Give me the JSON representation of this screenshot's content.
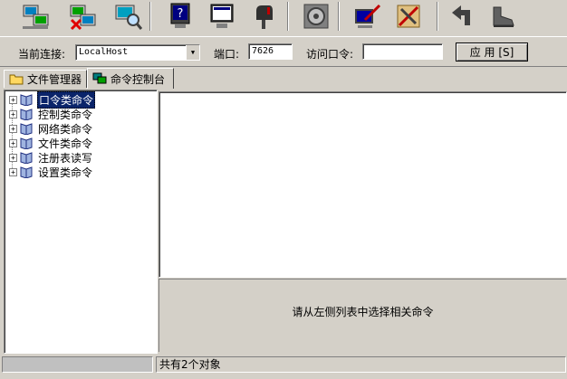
{
  "toolbar": {
    "buttons": [
      {
        "icon": "computer-connect-icon"
      },
      {
        "icon": "computer-disconnect-icon"
      },
      {
        "icon": "computer-search-icon"
      },
      {
        "icon": "help-monitor-icon"
      },
      {
        "icon": "monitor-screen-icon"
      },
      {
        "icon": "mailbox-icon"
      },
      {
        "icon": "gear-settings-icon"
      },
      {
        "icon": "edit-monitor-icon"
      },
      {
        "icon": "tools-icon"
      },
      {
        "icon": "return-icon"
      },
      {
        "icon": "boot-icon"
      }
    ]
  },
  "connection": {
    "current_label": "当前连接:",
    "current_value": "LocalHost",
    "port_label": "端口:",
    "port_value": "7626",
    "password_label": "访问口令:",
    "password_value": "",
    "apply_label": "应 用 [S]"
  },
  "tabs": [
    {
      "label": "文件管理器",
      "icon": "folder-icon",
      "active": false
    },
    {
      "label": "命令控制台",
      "icon": "console-icon",
      "active": true
    }
  ],
  "tree": {
    "items": [
      {
        "label": "口令类命令",
        "selected": true
      },
      {
        "label": "控制类命令",
        "selected": false
      },
      {
        "label": "网络类命令",
        "selected": false
      },
      {
        "label": "文件类命令",
        "selected": false
      },
      {
        "label": "注册表读写",
        "selected": false
      },
      {
        "label": "设置类命令",
        "selected": false
      }
    ]
  },
  "hint_text": "请从左侧列表中选择相关命令",
  "status": {
    "left": "",
    "right": "共有2个对象"
  },
  "colors": {
    "face": "#d4d0c8",
    "selection": "#0a246a"
  }
}
